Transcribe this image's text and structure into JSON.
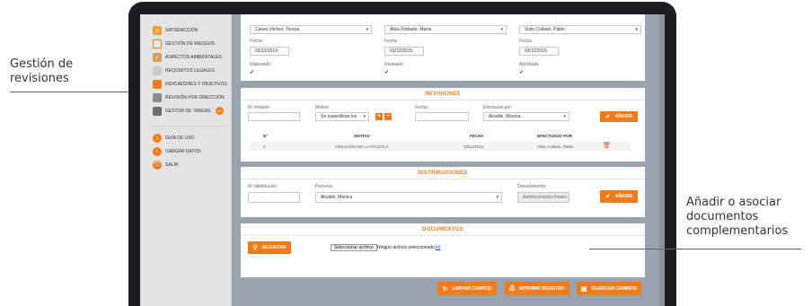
{
  "annotations": {
    "left": "Gestión de revisiones",
    "right": "Añadir o asociar documentos complementarios"
  },
  "sidebar": {
    "items": [
      {
        "label": "Satisfacción",
        "icon": "satisfaction-icon"
      },
      {
        "label": "Gestión de riesgos",
        "icon": "risk-icon"
      },
      {
        "label": "Aspectos ambientales",
        "icon": "environment-icon"
      },
      {
        "label": "Requisitos legales",
        "icon": "legal-icon"
      },
      {
        "label": "Indicadores y objetivos",
        "icon": "indicators-icon"
      },
      {
        "label": "Revisión por dirección",
        "icon": "review-icon"
      },
      {
        "label": "Gestor de tareas",
        "icon": "tasks-icon",
        "badge": "99"
      },
      {
        "label": "Guía de uso",
        "icon": "info-icon"
      },
      {
        "label": "Cargar datos",
        "icon": "upload-icon"
      },
      {
        "label": "Salir",
        "icon": "power-icon"
      }
    ]
  },
  "approval": {
    "elaborado_por": "Casas Vilchez, Teresa",
    "revisado_por": "Aliza Poblado, Marta",
    "aprobado_por": "Visto Collado, Pablo",
    "fecha_label": "Fecha",
    "fecha1": "03/12/2014",
    "fecha2": "03/12/2015",
    "fecha3": "03/12/2015",
    "elaborado_label": "Elaborado",
    "revisado_label": "Revisado",
    "aprobado_label": "Aprobado"
  },
  "revisiones": {
    "title": "REVISIONES",
    "nrev_label": "Nº revisión",
    "motivo_label": "Motivo",
    "motivo_value": "Se especifican los",
    "fecha_label": "Fecha",
    "efectuado_label": "Efectuado por",
    "efectuado_value": "Alcalde, Monica",
    "add_label": "Añadir",
    "columns": [
      "Nº",
      "MOTIVO",
      "FECHA",
      "EFECTUADO POR"
    ],
    "rows": [
      {
        "n": "0",
        "motivo": "CREACIÓN DE LA POLÍTICA",
        "fecha": "03/12/2012",
        "efectuado": "Visto Collado, Pablo"
      }
    ]
  },
  "distribuciones": {
    "title": "DISTRIBUCIONES",
    "ndist_label": "Nº distribución",
    "persona_label": "Persona",
    "persona_value": "Alcalde, Monica",
    "departamento_label": "Departamento",
    "departamento_value": "Administración-Financ",
    "add_label": "Añadir"
  },
  "documentos": {
    "title": "DOCUMENTOS",
    "adjuntar_label": "Adjuntar",
    "file_button": "Seleccionar archivo",
    "file_status": "Ningún archivo seleccionado",
    "clear_link": "[x]"
  },
  "footer": {
    "limpiar": "Limpiar campos",
    "imprimir": "Imprimir registro",
    "guardar": "Guardar cambios"
  },
  "colors": {
    "accent": "#f07b1a",
    "main_bg": "#9aa4af",
    "sidebar_bg": "#e4e4e4"
  }
}
